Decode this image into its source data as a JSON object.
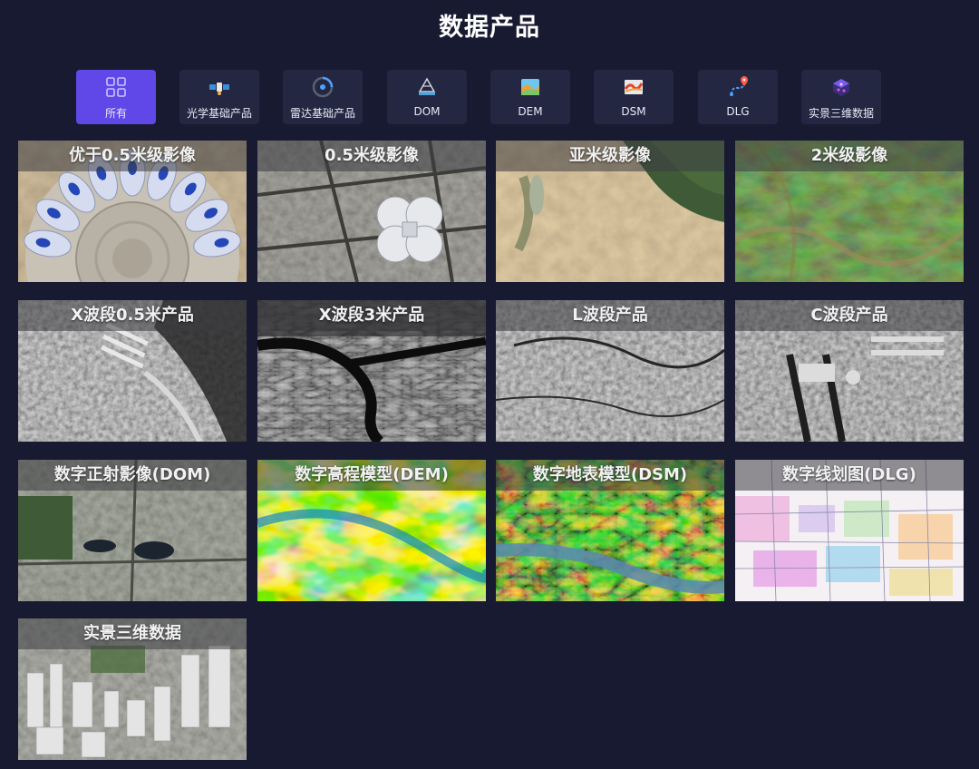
{
  "header": {
    "title": "数据产品"
  },
  "tabs": [
    {
      "label": "所有",
      "icon": "grid-icon",
      "active": true
    },
    {
      "label": "光学基础产品",
      "icon": "satellite-icon"
    },
    {
      "label": "雷达基础产品",
      "icon": "radar-icon"
    },
    {
      "label": "DOM",
      "icon": "pyramid-layers-icon"
    },
    {
      "label": "DEM",
      "icon": "elevation-map-icon"
    },
    {
      "label": "DSM",
      "icon": "surface-map-icon"
    },
    {
      "label": "DLG",
      "icon": "route-pin-icon"
    },
    {
      "label": "实景三维数据",
      "icon": "3d-cube-icon"
    }
  ],
  "products": [
    {
      "title": "优于0.5米级影像",
      "image": "stadium-aerial-image"
    },
    {
      "title": "0.5米级影像",
      "image": "convention-center-aerial-image"
    },
    {
      "title": "亚米级影像",
      "image": "desert-farmland-image"
    },
    {
      "title": "2米级影像",
      "image": "mountain-terrain-image"
    },
    {
      "title": "X波段0.5米产品",
      "image": "sar-x-band-0.5m-image"
    },
    {
      "title": "X波段3米产品",
      "image": "sar-x-band-3m-river-image"
    },
    {
      "title": "L波段产品",
      "image": "sar-l-band-image"
    },
    {
      "title": "C波段产品",
      "image": "sar-c-band-airport-image"
    },
    {
      "title": "数字正射影像(DOM)",
      "image": "orthophoto-image"
    },
    {
      "title": "数字高程模型(DEM)",
      "image": "dem-colored-relief-image"
    },
    {
      "title": "数字地表模型(DSM)",
      "image": "dsm-colored-relief-image"
    },
    {
      "title": "数字线划图(DLG)",
      "image": "line-map-image"
    },
    {
      "title": "实景三维数据",
      "image": "3d-city-model-image"
    }
  ],
  "colors": {
    "background": "#171a30",
    "tab": "#232741",
    "tab_active": "#6048e8"
  }
}
